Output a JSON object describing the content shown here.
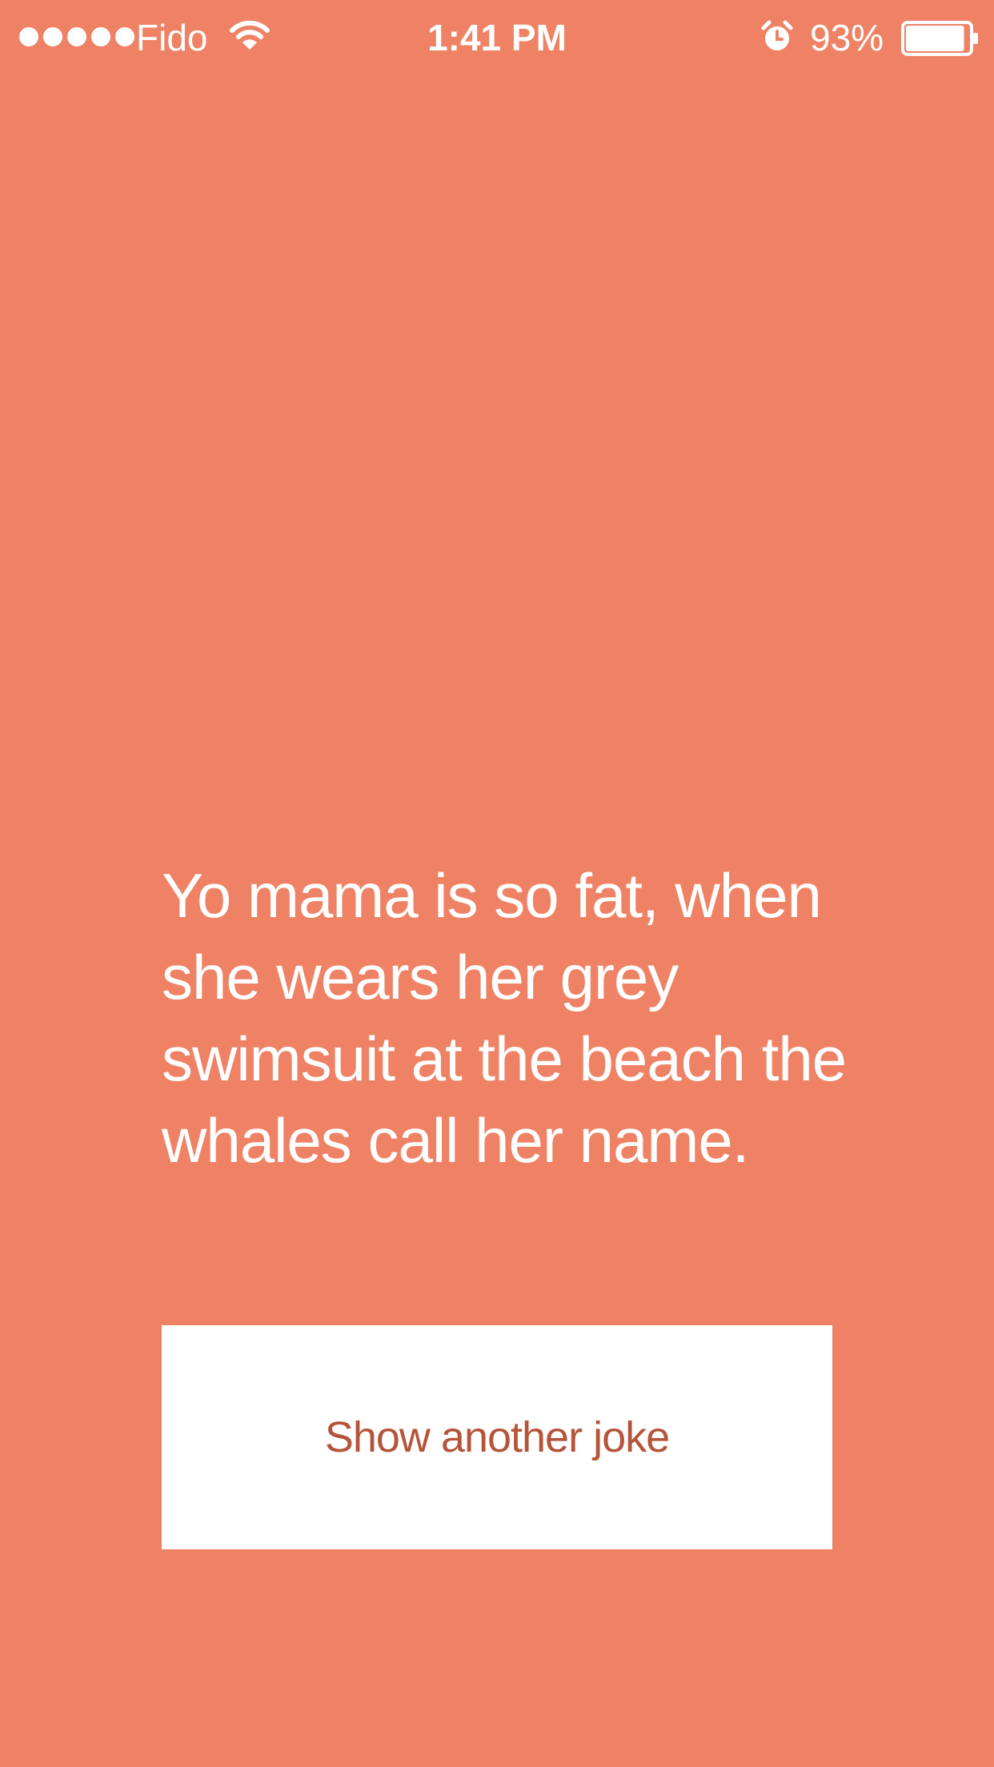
{
  "status_bar": {
    "carrier": "Fido",
    "time": "1:41 PM",
    "battery_percent": "93%",
    "signal_bars": 5,
    "battery_level": 0.93,
    "icons": [
      "wifi-icon",
      "alarm-icon",
      "battery-icon"
    ]
  },
  "joke": {
    "text": "Yo mama is so fat, when she wears her grey swimsuit at the beach the whales call her name."
  },
  "actions": {
    "show_another_label": "Show another joke"
  },
  "colors": {
    "background": "#ef8265",
    "button_background": "#ffffff",
    "button_text": "#b5543a",
    "text": "#ffffff"
  }
}
